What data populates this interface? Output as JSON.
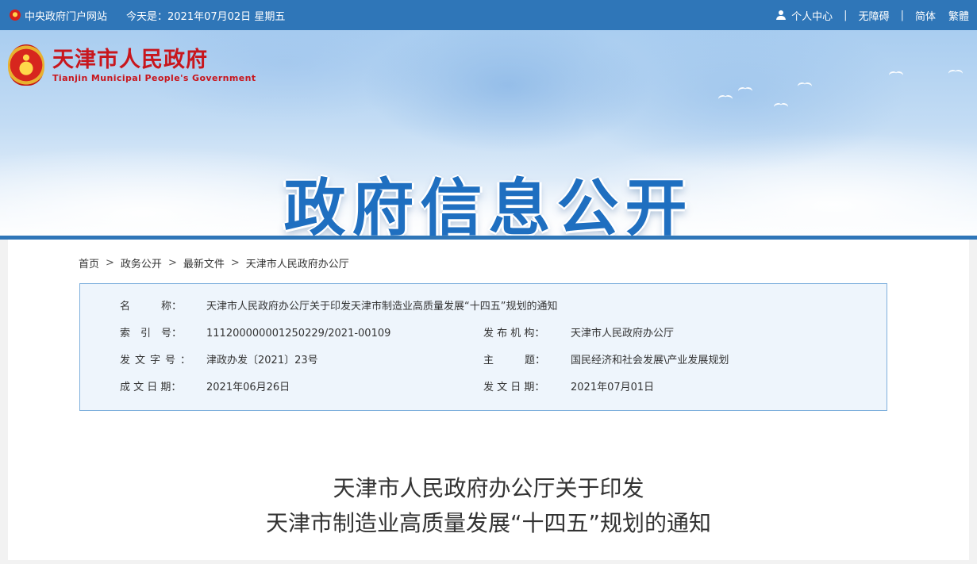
{
  "topbar": {
    "portal": "中央政府门户网站",
    "date": "今天是：2021年07月02日 星期五",
    "personal_center": "个人中心",
    "accessibility": "无障碍",
    "simplified": "简体",
    "traditional": "繁體",
    "separator": "|"
  },
  "banner": {
    "logo_cn": "天津市人民政府",
    "logo_en": "Tianjin Municipal People's Government",
    "title": "政府信息公开"
  },
  "breadcrumb": {
    "items": [
      "首页",
      "政务公开",
      "最新文件",
      "天津市人民政府办公厅"
    ],
    "sep": ">"
  },
  "info": {
    "name_label": "名　　　称：",
    "name_value": "天津市人民政府办公厅关于印发天津市制造业高质量发展“十四五”规划的通知",
    "index_label": "索　引　号：",
    "index_value": "111200000001250229/2021-00109",
    "publisher_label": "发 布 机 构：",
    "publisher_value": "天津市人民政府办公厅",
    "docno_label": "发文字号：",
    "docno_value": "津政办发〔2021〕23号",
    "topic_label": "主　　　题：",
    "topic_value": "国民经济和社会发展\\产业发展规划",
    "written_label": "成 文 日 期：",
    "written_value": "2021年06月26日",
    "published_label": "发 文 日 期：",
    "published_value": "2021年07月01日"
  },
  "document": {
    "title_line1": "天津市人民政府办公厅关于印发",
    "title_line2": "天津市制造业高质量发展“十四五”规划的通知"
  }
}
